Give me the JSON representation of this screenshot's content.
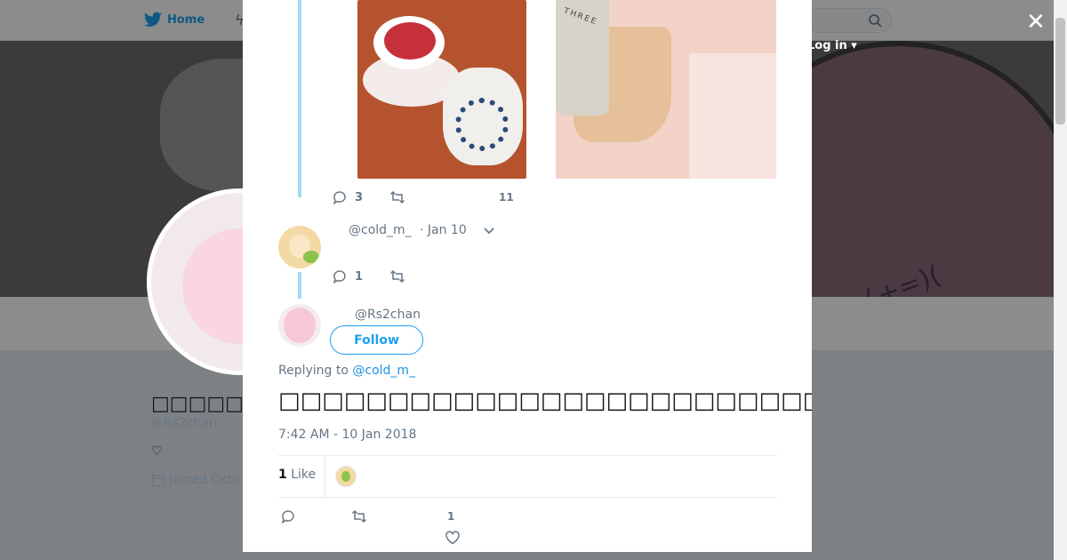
{
  "nav": {
    "home_label": "Home",
    "login_label": "Log in",
    "search_placeholder": ""
  },
  "profile": {
    "name": "□□□□□□",
    "handle": "@Rs2chan",
    "bio": "♡",
    "joined": "Joined Octo"
  },
  "modal": {
    "parent_tweet": {
      "reply_count": "3",
      "like_count": "11"
    },
    "middle_tweet": {
      "handle": "@cold_m_",
      "date": "· Jan 10",
      "reply_count": "1"
    },
    "main_tweet": {
      "handle": "@Rs2chan",
      "follow_label": "Follow",
      "replying_prefix": "Replying to",
      "replying_to": "@cold_m_",
      "text": "□□□□□□□□□□□□□□□□□□□□□□□□□□□□□□□( ˘o˘ )♪",
      "timestamp": "7:42 AM - 10 Jan 2018",
      "like_stat_count": "1",
      "like_stat_label": "Like",
      "footer_like_count": "1"
    },
    "photo_bottle_label": "THREE"
  },
  "colors": {
    "accent": "#1da1f2",
    "thread_line": "#a4d9f4",
    "muted_text": "#657786"
  },
  "icons": [
    "twitter-bird-icon",
    "lightning-icon",
    "search-icon",
    "close-icon",
    "reply-icon",
    "retweet-icon",
    "heart-icon",
    "chevron-down-icon",
    "calendar-icon"
  ]
}
